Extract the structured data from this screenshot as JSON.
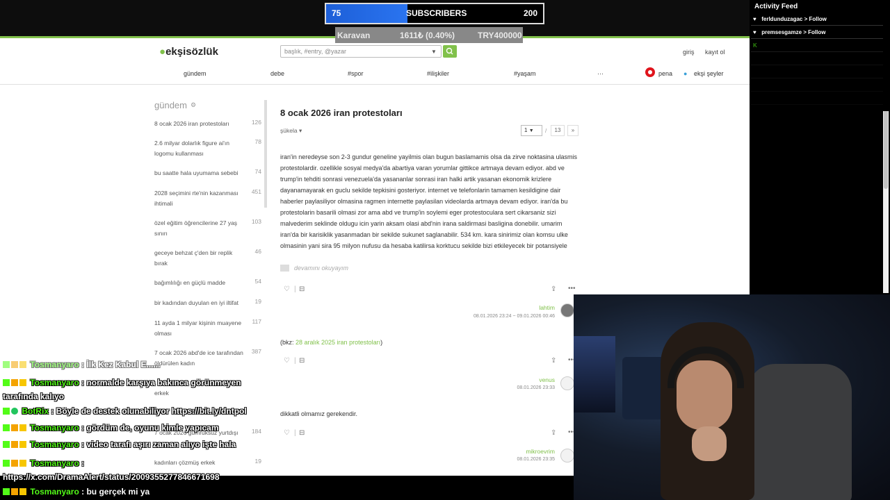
{
  "stream": {
    "subscriber_goal": {
      "current": "75",
      "label": "SUBSCRIBERS",
      "goal": "200",
      "progress_fraction": 0.375
    },
    "ticker": {
      "name": "Karavan",
      "amount": "1611₺ (0.40%)",
      "target": "TRY400000"
    }
  },
  "activity_feed": {
    "title": "Activity Feed",
    "items": [
      "ferldunduzagac > Follow",
      "premsesgamze > Follow",
      "",
      "",
      "",
      "",
      ""
    ]
  },
  "browser": {
    "site": {
      "logo": "ekşisözlük"
    },
    "search": {
      "placeholder": "başlık, #entry, @yazar"
    },
    "auth": {
      "login": "giriş",
      "register": "kayıt ol"
    },
    "nav": {
      "items": [
        "gündem",
        "debe",
        "#spor",
        "#ilişkiler",
        "#yaşam",
        "···"
      ],
      "pena": "pena",
      "eksi_seyler": "ekşi şeyler"
    },
    "sidebar": {
      "title": "gündem",
      "items": [
        {
          "label": "8 ocak 2026 iran protestoları",
          "count": "126"
        },
        {
          "label": "2.6 milyar dolarlık figure ai'ın logomu kullanması",
          "count": "78"
        },
        {
          "label": "bu saatte hala uyumama sebebi",
          "count": "74"
        },
        {
          "label": "2028 seçimini rte'nin kazanması ihtimali",
          "count": "451"
        },
        {
          "label": "özel eğitim öğrencilerine 27 yaş sınırı",
          "count": "103"
        },
        {
          "label": "geceye behzat ç'den bir replik bırak",
          "count": "46"
        },
        {
          "label": "bağımlılığı en güçlü madde",
          "count": "54"
        },
        {
          "label": "bir kadından duyulan en iyi iltifat",
          "count": "19"
        },
        {
          "label": "11 ayda 1 milyar kişinin muayene olması",
          "count": "117"
        },
        {
          "label": "7 ocak 2026 abd'de ice tarafından öldürülen kadın",
          "count": "387"
        },
        {
          "label": "erkek",
          "count": ""
        },
        {
          "label": "7 ocak 2026 gümrüksüz yurtdışı",
          "count": "184"
        },
        {
          "label": "kadınları çözmüş erkek",
          "count": "19"
        }
      ]
    },
    "topic": {
      "title": "8 ocak 2026 iran protestoları",
      "sort_label": "şükela",
      "pagination": {
        "current": "1",
        "separator": "/",
        "total": "13",
        "next": "»"
      },
      "entries": [
        {
          "text": "iran'in neredeyse son 2-3 gundur geneline yayilmis olan bugun baslamamis olsa da zirve noktasina ulasmis protestolardir. ozellikle sosyal medya'da abartiya varan yorumlar gittikce artmaya devam ediyor. abd ve trump'in tehditi sonrasi venezuela'da yasananlar sonrasi iran halki artik yasanan ekonomik krizlere dayanamayarak en guclu sekilde tepkisini gosteriyor. internet ve telefonlarin tamamen kesildigine dair haberler paylasiliyor olmasina ragmen internette paylasilan videolarda artmaya devam ediyor. iran'da bu protestolarin basarili olmasi zor ama abd ve trump'in soylemi eger protestoculara sert cikarsaniz sizi malvederim seklinde oldugu icin yarin aksam olasi abd'nin irana saldirmasi basligina donebilir. umarim iran'da bir karisiklik yasanmadan bir sekilde sukunet saglanabilir. 534 km. kara sinirimiz olan komsu ulke olmasinin yani sira 95 milyon nufusu da hesaba katilirsa korktucu sekilde bizi etkileyecek bir potansiyele",
          "more": "devamını okuyayım",
          "author": "lahtim",
          "date": "08.01.2026 23:24 ~ 09.01.2026 00:46"
        },
        {
          "prefix": "(bkz: ",
          "link": "28 aralık 2025 iran protestoları",
          "suffix": ")",
          "author": "venus",
          "date": "08.01.2026 23:33"
        },
        {
          "text": "dikkatli olmamız gerekendir.",
          "author": "mikroevrim",
          "date": "08.01.2026 23:35"
        }
      ]
    }
  },
  "chat": [
    {
      "user": "Tosmanyaro",
      "message": " : İlk Kez Kabul E......",
      "faded": true
    },
    {
      "user": "Tosmanyaro",
      "message": " : normalde karşıya bakınca görünmeyen tarafında kalıyo"
    },
    {
      "user": "BotRix",
      "message": " : Böyle de destek olunabiliyor https://bit.ly/dntpol"
    },
    {
      "user": "Tosmanyaro",
      "message": " : gördüm de, oyunu kimle yapıcam"
    },
    {
      "user": "Tosmanyaro",
      "message": " : video tarafı aşırı zaman alıyo işte hala"
    },
    {
      "user": "Tosmanyaro",
      "message": " : https://x.com/DramaAlert/status/2009355277846671698"
    },
    {
      "user": "Tosmanyaro",
      "message": " : bu gerçek mi ya"
    }
  ],
  "colors": {
    "brand_green": "#81c14b",
    "kick_green": "#53fc18",
    "subs_blue": "#2a74f0",
    "pena_red": "#e0141c"
  },
  "icons": [
    "search-icon",
    "gear-icon",
    "heart-icon",
    "minus-icon",
    "share-icon",
    "more-icon",
    "pena-icon",
    "drop-icon"
  ]
}
